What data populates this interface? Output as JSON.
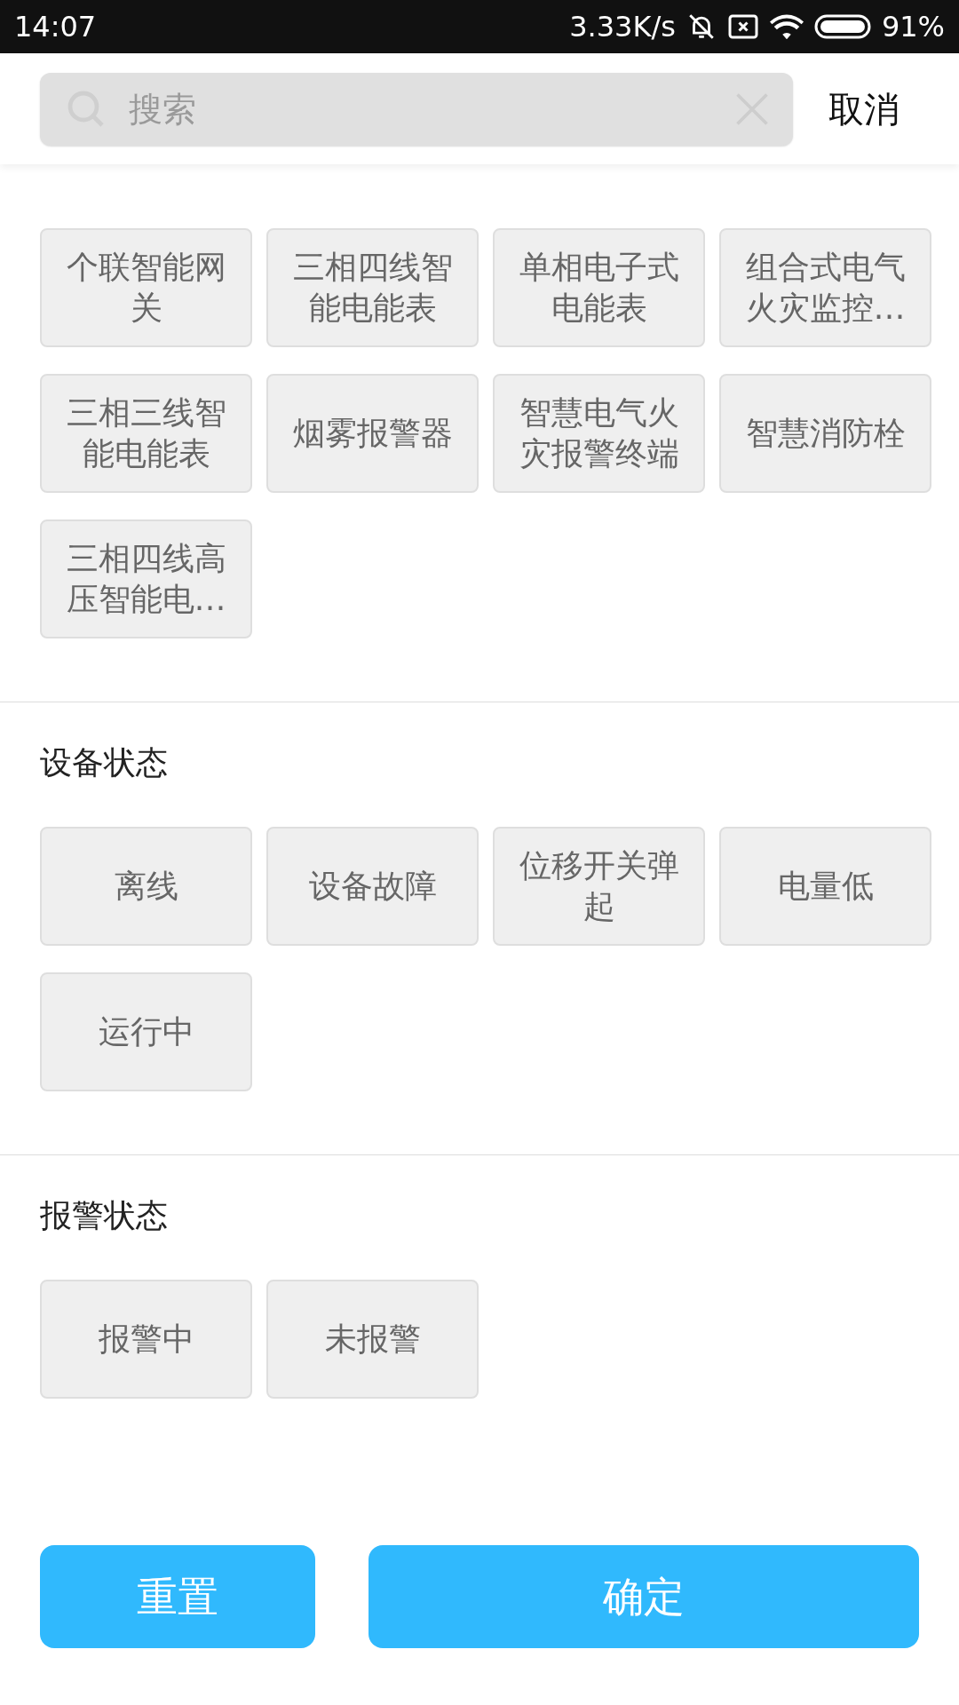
{
  "status_bar": {
    "time": "14:07",
    "speed": "3.33K/s",
    "battery": "91%"
  },
  "search": {
    "placeholder": "搜索",
    "cancel": "取消"
  },
  "sections": [
    {
      "chips": [
        "个联智能网关",
        "三相四线智能电能表",
        "单相电子式电能表",
        "组合式电气火灾监控…",
        "三相三线智能电能表",
        "烟雾报警器",
        "智慧电气火灾报警终端",
        "智慧消防栓",
        "三相四线高压智能电…"
      ]
    },
    {
      "title": "设备状态",
      "chips": [
        "离线",
        "设备故障",
        "位移开关弹起",
        "电量低",
        "运行中"
      ]
    },
    {
      "title": "报警状态",
      "chips": [
        "报警中",
        "未报警"
      ]
    }
  ],
  "buttons": {
    "reset": "重置",
    "confirm": "确定"
  }
}
